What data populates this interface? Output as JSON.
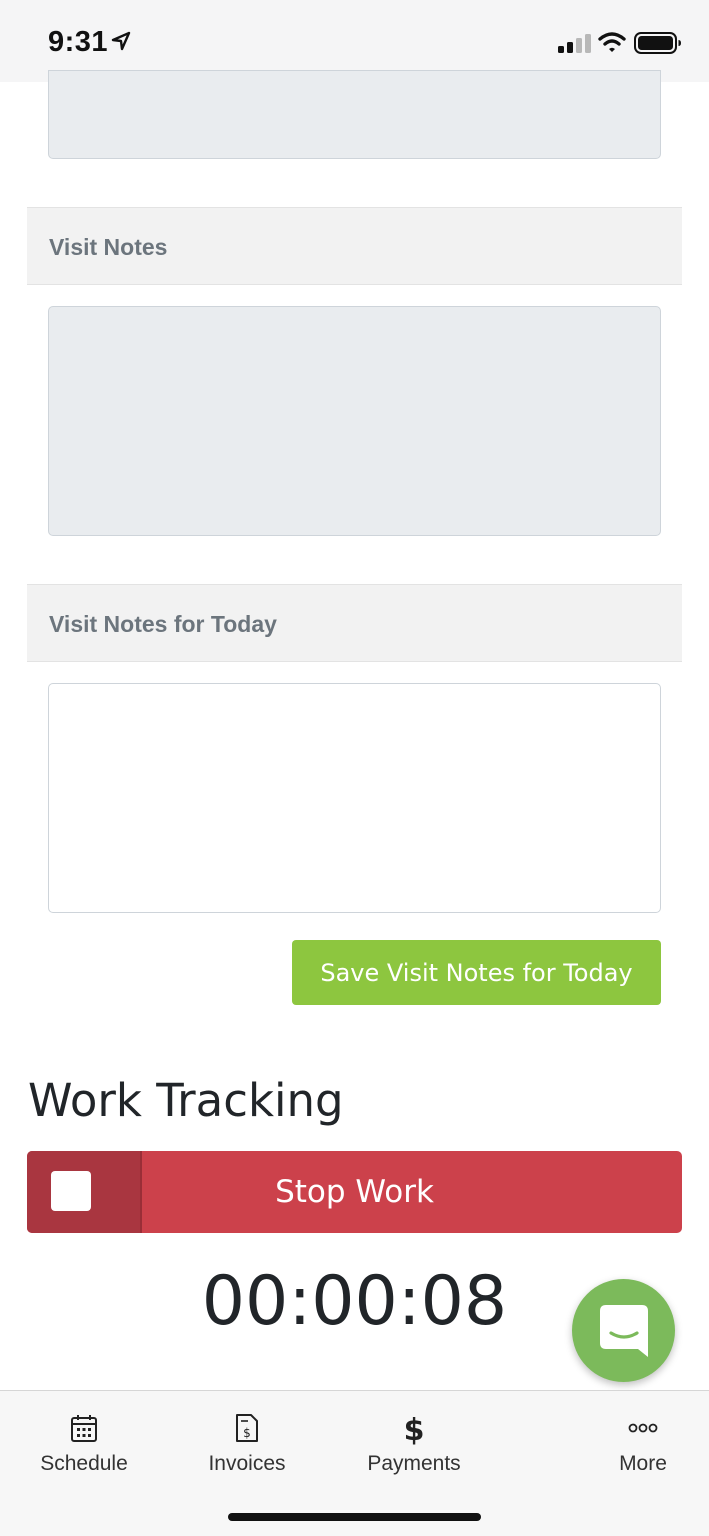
{
  "status_bar": {
    "time": "9:31"
  },
  "sections": {
    "visit_notes": {
      "title": "Visit Notes"
    },
    "visit_notes_today": {
      "title": "Visit Notes for Today",
      "value": ""
    }
  },
  "save_button": {
    "label": "Save Visit Notes for Today"
  },
  "work_tracking": {
    "title": "Work Tracking",
    "stop_label": "Stop Work",
    "timer": "00:00:08"
  },
  "tab_bar": {
    "items": [
      {
        "label": "Schedule",
        "icon": "calendar-icon"
      },
      {
        "label": "Invoices",
        "icon": "invoice-icon"
      },
      {
        "label": "Payments",
        "icon": "dollar-icon"
      },
      {
        "label": "More",
        "icon": "more-icon"
      }
    ]
  },
  "colors": {
    "accent_green": "#8dc63f",
    "stop_red": "#cc414b",
    "chat_green": "#7cba5b"
  }
}
